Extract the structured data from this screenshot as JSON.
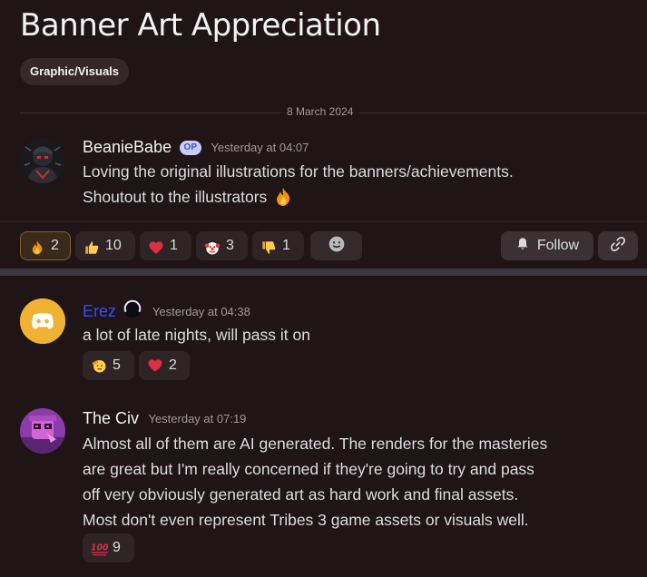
{
  "thread": {
    "title": "Banner Art Appreciation",
    "tag": "Graphic/Visuals",
    "date_divider": "8 March 2024"
  },
  "op_message": {
    "author": "BeanieBabe",
    "badge": "OP",
    "timestamp": "Yesterday at 04:07",
    "lines": [
      "Loving the original illustrations for the banners/achievements.",
      "Shoutout to the illustrators"
    ],
    "inline_emoji": "fire-emoji"
  },
  "op_reactions": [
    {
      "emoji": "fire-emoji",
      "count": "2",
      "active": true
    },
    {
      "emoji": "thumbs-up-emoji",
      "count": "10"
    },
    {
      "emoji": "heart-emoji",
      "count": "1"
    },
    {
      "emoji": "clown-emoji",
      "count": "3"
    },
    {
      "emoji": "thumbs-down-emoji",
      "count": "1"
    }
  ],
  "actions": {
    "follow_label": "Follow",
    "add_reaction_icon": "smiley-icon",
    "link_icon": "link-icon"
  },
  "replies": [
    {
      "author": "Erez",
      "author_color": "#3b4df0",
      "timestamp": "Yesterday at 04:38",
      "text": "a lot of late nights, will pass it on",
      "reactions": [
        {
          "emoji": "saluting-face-emoji",
          "count": "5"
        },
        {
          "emoji": "heart-emoji",
          "count": "2"
        }
      ]
    },
    {
      "author": "The Civ",
      "author_color": "#f2f3f5",
      "timestamp": "Yesterday at 07:19",
      "lines": [
        "Almost all of them are AI generated. The renders for the masteries",
        "are great but I'm really concerned if they're going to try and pass",
        "off very obviously generated art as hard work and final assets.",
        "Most don't even represent Tribes 3 game assets or visuals well."
      ],
      "reactions": [
        {
          "emoji": "hundred-points-emoji",
          "count": "9"
        }
      ]
    }
  ],
  "colors": {
    "background": "#1f1416",
    "blurple": "#5865f2",
    "heart": "#f23f43"
  }
}
